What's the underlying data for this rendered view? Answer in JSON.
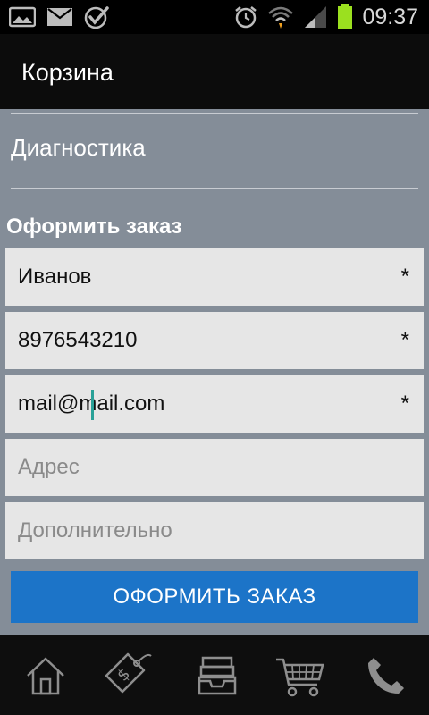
{
  "status_bar": {
    "time": "09:37",
    "left_icons": [
      "gallery-icon",
      "mail-icon",
      "checkmark-icon"
    ],
    "right_icons": [
      "alarm-icon",
      "wifi-icon",
      "signal-icon",
      "battery-icon"
    ],
    "battery_color": "#9be01f"
  },
  "action_bar": {
    "title": "Корзина"
  },
  "cart": {
    "item_name": "Диагностика"
  },
  "order_form": {
    "title": "Оформить заказ",
    "fields": [
      {
        "value": "Иванов",
        "placeholder": "",
        "required_mark": "*"
      },
      {
        "value": "8976543210",
        "placeholder": "",
        "required_mark": "*"
      },
      {
        "value": "mail@mail.com",
        "placeholder": "",
        "required_mark": "*"
      },
      {
        "value": "",
        "placeholder": "Адрес",
        "required_mark": ""
      },
      {
        "value": "",
        "placeholder": "Дополнительно",
        "required_mark": ""
      }
    ],
    "submit_label": "ОФОРМИТЬ ЗАКАЗ",
    "submit_color": "#1c74c8"
  },
  "bottom_nav": {
    "items": [
      "home-icon",
      "price-tag-icon",
      "inbox-tray-icon",
      "cart-icon",
      "phone-icon"
    ]
  },
  "colors": {
    "content_background": "#848d98",
    "field_background": "#e6e6e6"
  }
}
